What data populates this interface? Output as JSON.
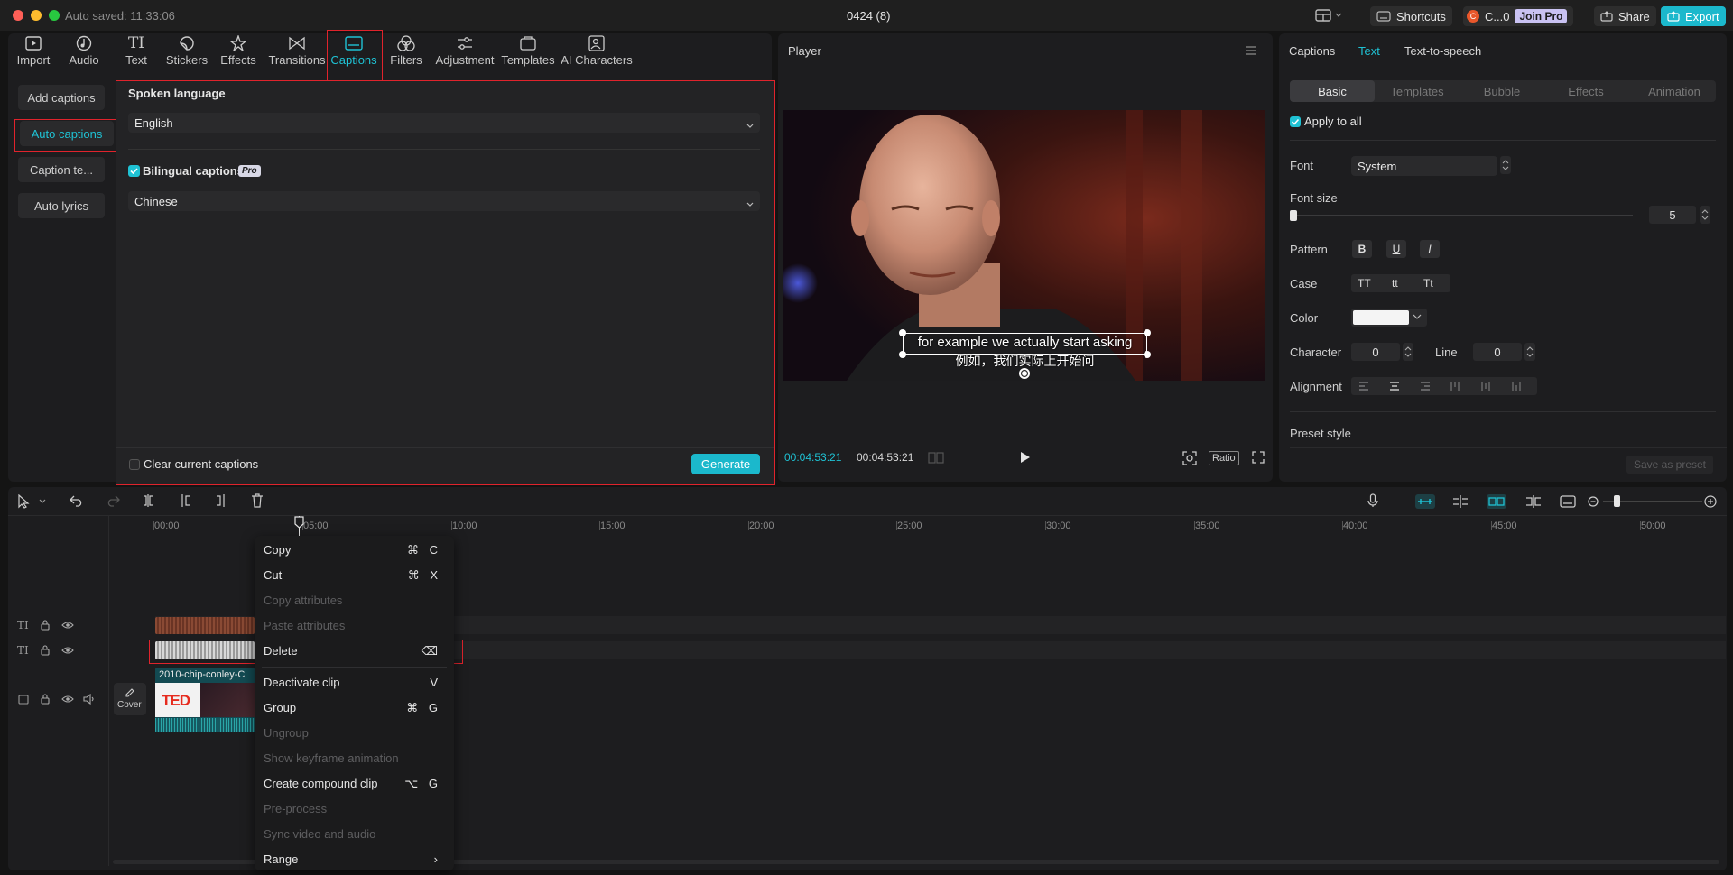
{
  "titlebar": {
    "autosave": "Auto saved: 11:33:06",
    "project_title": "0424 (8)",
    "shortcuts_label": "Shortcuts",
    "user_label": "C...0",
    "join_pro_label": "Join Pro",
    "share_label": "Share",
    "export_label": "Export"
  },
  "toolbar": {
    "items": [
      {
        "label": "Import",
        "icon": "import-icon"
      },
      {
        "label": "Audio",
        "icon": "audio-icon"
      },
      {
        "label": "Text",
        "icon": "text-icon"
      },
      {
        "label": "Stickers",
        "icon": "stickers-icon"
      },
      {
        "label": "Effects",
        "icon": "effects-icon"
      },
      {
        "label": "Transitions",
        "icon": "transitions-icon"
      },
      {
        "label": "Captions",
        "icon": "captions-icon"
      },
      {
        "label": "Filters",
        "icon": "filters-icon"
      },
      {
        "label": "Adjustment",
        "icon": "adjustment-icon"
      },
      {
        "label": "Templates",
        "icon": "templates-icon"
      },
      {
        "label": "AI Characters",
        "icon": "ai-characters-icon"
      }
    ],
    "active": "Captions",
    "accent": "#1fc2d4"
  },
  "captions_sidebar": {
    "items": [
      "Add captions",
      "Auto captions",
      "Caption te...",
      "Auto lyrics"
    ],
    "active": "Auto captions"
  },
  "auto_captions": {
    "spoken_language_label": "Spoken language",
    "spoken_language_value": "English",
    "bilingual_label": "Bilingual captions",
    "bilingual_checked": true,
    "pro_badge": "Pro",
    "bilingual_language_value": "Chinese",
    "clear_label": "Clear current captions",
    "clear_checked": false,
    "generate_label": "Generate"
  },
  "player": {
    "title": "Player",
    "caption_line1": "for example we actually start asking",
    "caption_line2": "例如，我们实际上开始问",
    "time_current": "00:04:53:21",
    "time_total": "00:04:53:21",
    "ratio_label": "Ratio"
  },
  "right_panel": {
    "tabs": [
      "Captions",
      "Text",
      "Text-to-speech"
    ],
    "active_tab": "Text",
    "subtabs": [
      "Basic",
      "Templates",
      "Bubble",
      "Effects",
      "Animation"
    ],
    "active_subtab": "Basic",
    "apply_all_label": "Apply to all",
    "apply_all_checked": true,
    "font_label": "Font",
    "font_value": "System",
    "font_size_label": "Font size",
    "font_size_value": "5",
    "pattern_label": "Pattern",
    "pattern_buttons": [
      "B",
      "U",
      "I"
    ],
    "case_label": "Case",
    "case_buttons": [
      "TT",
      "tt",
      "Tt"
    ],
    "color_label": "Color",
    "color_value": "#ffffff",
    "character_label": "Character",
    "character_value": "0",
    "line_label": "Line",
    "line_value": "0",
    "alignment_label": "Alignment",
    "preset_label": "Preset style",
    "save_preset_label": "Save as preset"
  },
  "timeline": {
    "ticks": [
      "00:00",
      "05:00",
      "10:00",
      "15:00",
      "20:00",
      "25:00",
      "30:00",
      "35:00",
      "40:00",
      "45:00",
      "50:00"
    ],
    "video_clip_name": "2010-chip-conley-C",
    "cover_label": "Cover",
    "ted_logo": "TED"
  },
  "context_menu": {
    "items": [
      {
        "label": "Copy",
        "shortcut": "⌘ C",
        "enabled": true
      },
      {
        "label": "Cut",
        "shortcut": "⌘ X",
        "enabled": true
      },
      {
        "label": "Copy attributes",
        "shortcut": "",
        "enabled": false
      },
      {
        "label": "Paste attributes",
        "shortcut": "",
        "enabled": false
      },
      {
        "label": "Delete",
        "shortcut": "⌫",
        "enabled": true
      },
      {
        "label": "Deactivate clip",
        "shortcut": "V",
        "enabled": true
      },
      {
        "label": "Group",
        "shortcut": "⌘ G",
        "enabled": true
      },
      {
        "label": "Ungroup",
        "shortcut": "",
        "enabled": false
      },
      {
        "label": "Show keyframe animation",
        "shortcut": "",
        "enabled": false
      },
      {
        "label": "Create compound clip",
        "shortcut": "⌥ G",
        "enabled": true
      },
      {
        "label": "Pre-process",
        "shortcut": "",
        "enabled": false
      },
      {
        "label": "Sync video and audio",
        "shortcut": "",
        "enabled": false
      },
      {
        "label": "Range",
        "shortcut": "›",
        "enabled": true
      }
    ],
    "highlighted": "Delete"
  }
}
